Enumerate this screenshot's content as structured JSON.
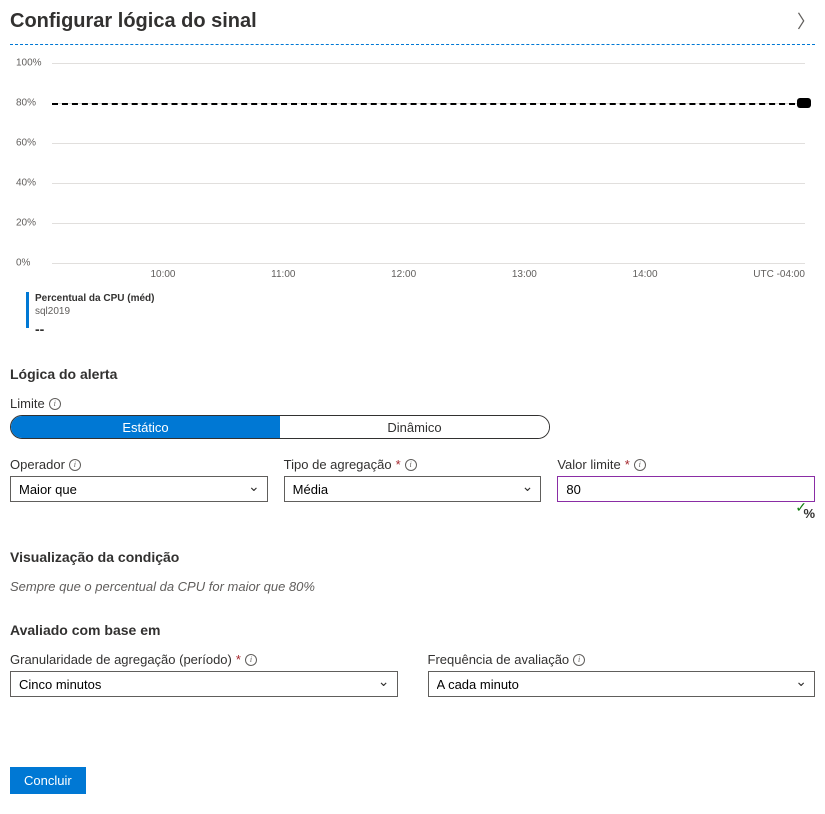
{
  "header": {
    "title": "Configurar lógica do sinal"
  },
  "chart_data": {
    "type": "line",
    "ylim": [
      0,
      100
    ],
    "yticks": [
      "0%",
      "20%",
      "40%",
      "60%",
      "80%",
      "100%"
    ],
    "threshold": 80,
    "xticks": [
      "",
      "10:00",
      "11:00",
      "12:00",
      "13:00",
      "14:00",
      "UTC -04:00"
    ],
    "legend": {
      "metric": "Percentual da CPU (méd)",
      "resource": "sql2019",
      "value": "--"
    },
    "series": []
  },
  "sections": {
    "alert_logic": "Lógica do alerta",
    "cond_preview": "Visualização da condição",
    "evaluated": "Avaliado com base em"
  },
  "fields": {
    "threshold_type": {
      "label": "Limite",
      "options": {
        "static": "Estático",
        "dynamic": "Dinâmico"
      },
      "selected": "static"
    },
    "operator": {
      "label": "Operador",
      "value": "Maior que"
    },
    "agg_type": {
      "label": "Tipo de agregação",
      "value": "Média"
    },
    "threshold_value": {
      "label": "Valor limite",
      "value": "80",
      "unit": "%"
    },
    "granularity": {
      "label": "Granularidade de agregação (período)",
      "value": "Cinco minutos"
    },
    "frequency": {
      "label": "Frequência de avaliação",
      "value": "A cada minuto"
    }
  },
  "condition_text": "Sempre que o percentual da CPU for maior que 80%",
  "buttons": {
    "done": "Concluir"
  }
}
